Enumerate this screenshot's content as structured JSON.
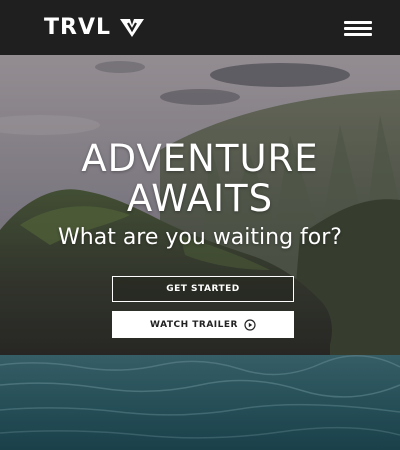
{
  "header": {
    "logo_text": "TRVL",
    "logo_icon": "chevron-shield-icon",
    "menu_icon": "hamburger-menu-icon"
  },
  "hero": {
    "title_line1": "ADVENTURE",
    "title_line2": "AWAITS",
    "subtitle": "What are you waiting for?",
    "primary_button": "GET STARTED",
    "secondary_button": "WATCH TRAILER",
    "secondary_button_icon": "play-circle-icon",
    "background": "coastal-cliffs-ocean-photo"
  },
  "colors": {
    "header_bg": "#1f1f1f",
    "text": "#ffffff",
    "solid_button_bg": "#ffffff",
    "solid_button_text": "#222222"
  }
}
